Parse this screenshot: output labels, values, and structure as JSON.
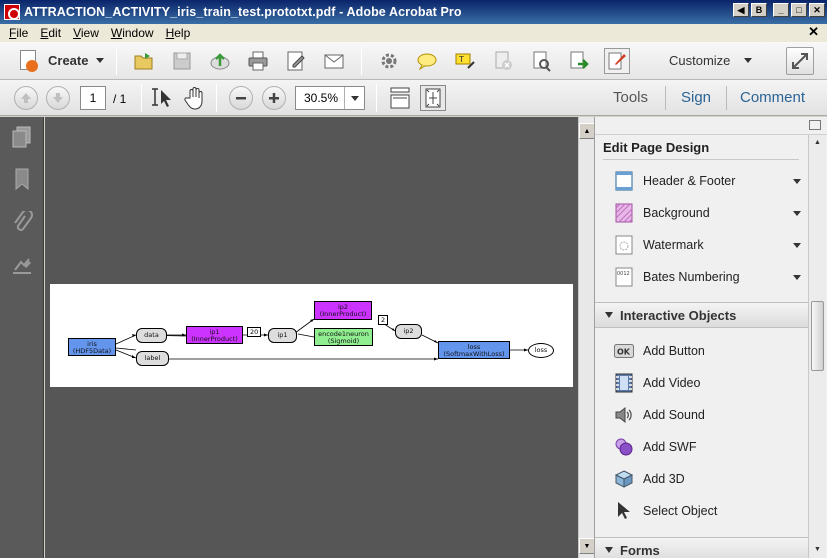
{
  "window": {
    "title": "ATTRACTION_ACTIVITY_iris_train_test.prototxt.pdf - Adobe Acrobat Pro"
  },
  "menu": [
    "File",
    "Edit",
    "View",
    "Window",
    "Help"
  ],
  "toolbar": {
    "create_label": "Create",
    "customize_label": "Customize"
  },
  "nav": {
    "page_current": "1",
    "page_total": "/ 1",
    "zoom": "30.5%"
  },
  "panels": {
    "tools": "Tools",
    "sign": "Sign",
    "comment": "Comment"
  },
  "right_panel": {
    "edit_page_design": {
      "title": "Edit Page Design",
      "items": [
        "Header & Footer",
        "Background",
        "Watermark",
        "Bates Numbering"
      ]
    },
    "interactive_objects": {
      "title": "Interactive Objects",
      "items": [
        "Add Button",
        "Add Video",
        "Add Sound",
        "Add SWF",
        "Add 3D",
        "Select Object"
      ]
    },
    "forms": {
      "title": "Forms"
    }
  },
  "diagram": {
    "nodes": {
      "iris": [
        "iris",
        "(HDF5Data)"
      ],
      "data": "data",
      "label": "label",
      "ip1_box": [
        "ip1",
        "(InnerProduct)"
      ],
      "ip1": "ip1",
      "ip2_box": [
        "ip2",
        "(InnerProduct)"
      ],
      "encode": [
        "encode1neuron",
        "(Sigmoid)"
      ],
      "ip2": "ip2",
      "loss_box": [
        "loss",
        "(SoftmaxWithLoss)"
      ],
      "loss": "loss"
    },
    "edge_labels": {
      "e20": "20",
      "e2": "2"
    }
  },
  "colors": {
    "data_layer": "#6495ed",
    "inner_product": "#cc33ff",
    "activation": "#90ee90"
  }
}
